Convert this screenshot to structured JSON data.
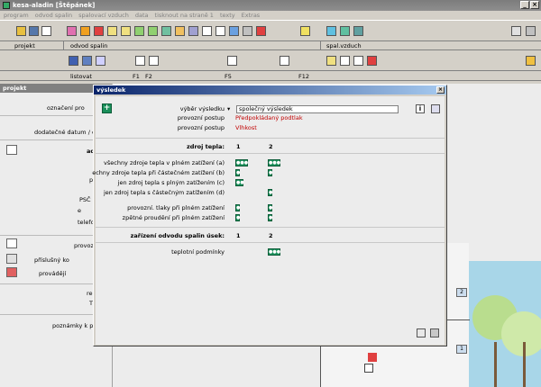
{
  "window": {
    "title": "kesa-aladin [Štěpánek]"
  },
  "menu": [
    "program",
    "odvod spalin",
    "spalovací vzduch",
    "data",
    "tisknout na straně 1",
    "texty",
    "Extras"
  ],
  "sections": {
    "projekt": "projekt",
    "odvod_spalin": "odvod spalin",
    "spal_vzduch": "spal.vzduch"
  },
  "keys": {
    "listovat": "listovat",
    "f1": "F1",
    "f2": "F2",
    "f5": "F5",
    "f12": "F12"
  },
  "projekt_panel": {
    "title": "projekt",
    "items": [
      "označení pro",
      "dodatečné datum / o",
      "ad",
      "pozn",
      "PSČ",
      "e",
      "telefo",
      "provoz",
      "příslušný ko",
      "provádějí",
      "re",
      "T",
      "poznámky k pro"
    ]
  },
  "dialog": {
    "title": "výsledek",
    "vyber_label": "výběr výsledku",
    "vyber_value": "společný výsledek",
    "provoz1_label": "provozní postup",
    "provoz1_value": "Předpokládaný podtlak",
    "provoz2_label": "provozní postup",
    "provoz2_value": "Vlhkost",
    "zdroj_label": "zdroj tepla:",
    "col1": "1",
    "col2": "2",
    "rows": [
      "všechny zdroje tepla v plném zatížení (a)",
      "echny zdroje tepla při částečném zatížení (b)",
      "jen zdroj tepla s plným zatížením (c)",
      "jen zdroj tepla s částečným zatížením (d)",
      "provozní. tlaky při plném zatížení",
      "zpětné proudění při plném zatížení"
    ],
    "zarizeni_label": "zařízení odvodu spalin úsek:",
    "zar_col1": "1",
    "zar_col2": "2",
    "teplotni_label": "teplotní podmínky",
    "info": "i"
  },
  "drawing": {
    "label1": "2",
    "label2": "1"
  },
  "colors": {
    "accent": "#1a8f5a",
    "title": "#0a246a",
    "red": "#c00000"
  }
}
